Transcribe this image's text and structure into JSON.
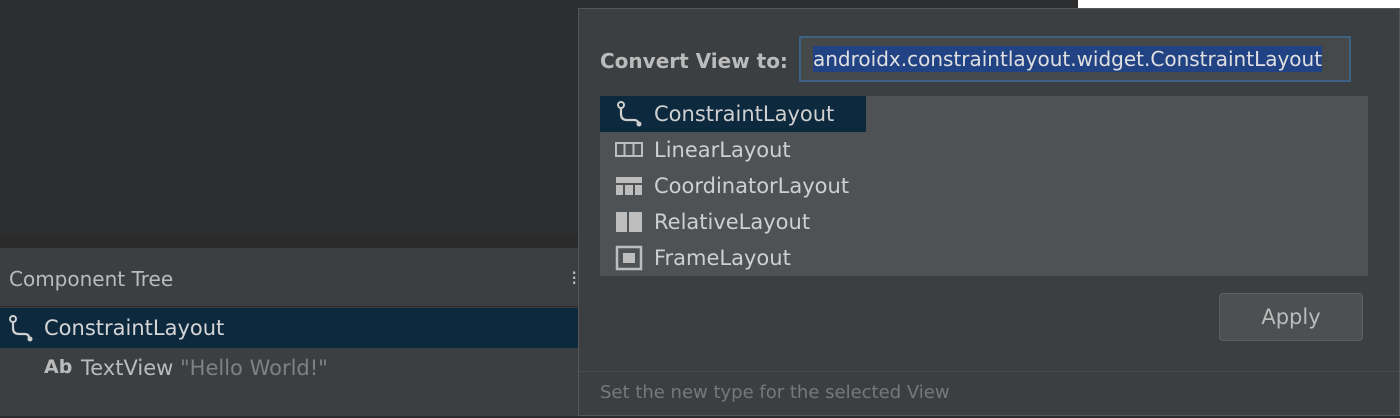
{
  "component_tree": {
    "title": "Component Tree",
    "items": [
      {
        "icon": "constraint-layout-icon",
        "label": "ConstraintLayout"
      },
      {
        "icon": "textview-icon",
        "icon_text": "Ab",
        "label": "TextView",
        "text": "\"Hello World!\""
      }
    ]
  },
  "dialog": {
    "label": "Convert View to:",
    "input_value": "androidx.constraintlayout.widget.ConstraintLayout",
    "options": [
      {
        "icon": "constraint-layout-icon",
        "label": "ConstraintLayout",
        "selected": true
      },
      {
        "icon": "linear-layout-icon",
        "label": "LinearLayout"
      },
      {
        "icon": "coordinator-layout-icon",
        "label": "CoordinatorLayout"
      },
      {
        "icon": "relative-layout-icon",
        "label": "RelativeLayout"
      },
      {
        "icon": "frame-layout-icon",
        "label": "FrameLayout"
      }
    ],
    "apply_label": "Apply",
    "footer_text": "Set the new type for the selected View"
  },
  "colors": {
    "selection": "#0d293e",
    "input_selection": "#214283",
    "panel": "#3c3f41"
  }
}
